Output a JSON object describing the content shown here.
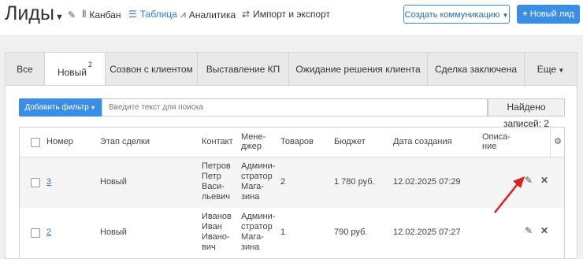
{
  "header": {
    "title": "Лиды",
    "views": [
      {
        "label": "Канбан",
        "icon": "kanban-icon"
      },
      {
        "label": "Таблица",
        "icon": "list-icon"
      },
      {
        "label": "Аналитика",
        "icon": "chart-line-icon"
      },
      {
        "label": "Импорт и экспорт",
        "icon": "import-export-icon"
      }
    ],
    "create_comm_label": "Создать коммуникацию",
    "new_lead_label": "Новый лид",
    "accent": "#3a8ee6"
  },
  "tabs": [
    {
      "label": "Все"
    },
    {
      "label": "Новый",
      "badge": "2",
      "active": true
    },
    {
      "label": "Созвон с клиентом"
    },
    {
      "label": "Выставление КП"
    },
    {
      "label": "Ожидание решения клиента"
    },
    {
      "label": "Сделка заключена"
    },
    {
      "label": "Еще"
    }
  ],
  "filter": {
    "add_filter_label": "Добавить фильтр",
    "search_placeholder": "Введите текст для поиска",
    "found_label": "Найдено записей: 2"
  },
  "table": {
    "headers": [
      "Номер",
      "Этап сделки",
      "Контакт",
      "Мене- джер",
      "Товаров",
      "Бюджет",
      "Дата создания",
      "Описа- ние"
    ],
    "rows": [
      {
        "number": "3",
        "stage": "Новый",
        "contact": [
          "Петров",
          "Петр",
          "Васи-",
          "льевич"
        ],
        "manager": [
          "Админи-",
          "стратор",
          "Мага-",
          "зина"
        ],
        "goods": "2",
        "budget": "1 780 руб.",
        "created": "12.02.2025 07:29",
        "description": ""
      },
      {
        "number": "2",
        "stage": "Новый",
        "contact": [
          "Иванов",
          "Иван",
          "Ивано-",
          "вич"
        ],
        "manager": [
          "Админи-",
          "стратор",
          "Мага-",
          "зина"
        ],
        "goods": "1",
        "budget": "790 руб.",
        "created": "12.02.2025 07:27",
        "description": ""
      }
    ]
  }
}
